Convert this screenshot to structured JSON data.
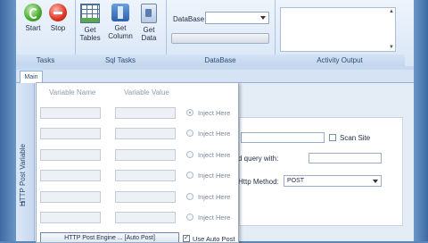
{
  "ribbon": {
    "tasks": {
      "label": "Tasks",
      "start": "Start",
      "stop": "Stop"
    },
    "sql_tasks": {
      "label": "Sql Tasks",
      "get_tables": "Get Tables",
      "get_column": "Get Column",
      "get_data": "Get Data"
    },
    "database": {
      "label": "DataBase",
      "field_label": "DataBase",
      "selected": ""
    },
    "activity": {
      "label": "Activity Output"
    }
  },
  "tabs": {
    "main": "Main"
  },
  "side_tab": {
    "label": "HTTP Post Variable"
  },
  "post_panel": {
    "variable_name_header": "Variable Name",
    "variable_value_header": "Variable Value",
    "rows": [
      {
        "inject": "Inject Here",
        "selected": true
      },
      {
        "inject": "Inject Here",
        "selected": false
      },
      {
        "inject": "Inject Here",
        "selected": false
      },
      {
        "inject": "Inject Here",
        "selected": false
      },
      {
        "inject": "Inject Here",
        "selected": false
      },
      {
        "inject": "Inject Here",
        "selected": false
      }
    ],
    "engine_button": "HTTP Post Engine ... [Auto Post]",
    "use_auto_post": "Use Auto Post",
    "use_auto_post_checked": true
  },
  "form": {
    "scan_site": "Scan Site",
    "query_label": "d query with:",
    "method_label": "Http Method:",
    "method_value": "POST"
  }
}
